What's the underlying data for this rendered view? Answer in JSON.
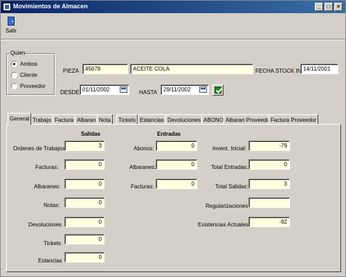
{
  "window": {
    "title": "Movimientos de Almacen"
  },
  "toolbar": {
    "exit_label": "Salir"
  },
  "quien": {
    "legend": "Quien",
    "options": [
      "Ambos",
      "Cliente",
      "Proveedor"
    ],
    "selected": "Ambos"
  },
  "header": {
    "pieza_label": "PIEZA",
    "pieza_code": "45678",
    "pieza_desc": "ACEITE COLA",
    "fecha_stock_label": "FECHA STOCK INI.",
    "fecha_stock_value": "14/11/2001",
    "desde_label": "DESDE",
    "desde_value": "01/11/2002",
    "hasta_label": "HASTA",
    "hasta_value": "29/11/2002"
  },
  "tabs": [
    "General",
    "Trabajo",
    "Factura",
    "Albaran",
    "Nota",
    "Tickets",
    "Estancias",
    "Devoluciones",
    "ABONO",
    "Albaran Proveedor",
    "Factura Proveedor"
  ],
  "salidas": {
    "heading": "Salidas",
    "rows": [
      {
        "label": "Ordenes de Trabajos:",
        "value": "3"
      },
      {
        "label": "Facturas:",
        "value": "0"
      },
      {
        "label": "Albaranes:",
        "value": "0"
      },
      {
        "label": "Notas:",
        "value": "0"
      },
      {
        "label": "Devoluciones",
        "value": "0"
      },
      {
        "label": "Tickets",
        "value": "0"
      },
      {
        "label": "Estancias",
        "value": "0"
      }
    ]
  },
  "entradas": {
    "heading": "Entradas",
    "rows": [
      {
        "label": "Abonos:",
        "value": "0"
      },
      {
        "label": "Albaranes:",
        "value": "0"
      },
      {
        "label": "Facturas:",
        "value": "0"
      }
    ]
  },
  "resumen": {
    "rows": [
      {
        "label": "Invent. Inicial:",
        "value": "-79"
      },
      {
        "label": "Total Entradas:",
        "value": "0"
      },
      {
        "label": "Total Salidas:",
        "value": "3"
      },
      {
        "label": "Regularizaciones:",
        "value": ""
      },
      {
        "label": "Existencias Actuales:",
        "value": "-92"
      }
    ]
  }
}
